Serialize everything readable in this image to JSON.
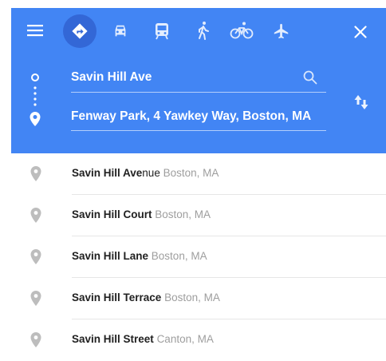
{
  "origin": {
    "value": "Savin Hill Ave"
  },
  "destination": {
    "value": "Fenway Park, 4 Yawkey Way, Boston, MA"
  },
  "suggestions": [
    {
      "match": "Savin Hill Ave",
      "rest": "nue",
      "locality": "Boston, MA"
    },
    {
      "match": "Savin Hill Court",
      "rest": "",
      "locality": "Boston, MA"
    },
    {
      "match": "Savin Hill Lane",
      "rest": "",
      "locality": "Boston, MA"
    },
    {
      "match": "Savin Hill Terrace",
      "rest": "",
      "locality": "Boston, MA"
    },
    {
      "match": "Savin Hill Street",
      "rest": "",
      "locality": "Canton, MA"
    }
  ],
  "icons": {
    "menu": "menu-icon",
    "modes": [
      "directions-icon",
      "car-icon",
      "transit-icon",
      "walk-icon",
      "bicycle-icon",
      "flight-icon"
    ],
    "close": "close-icon",
    "search": "search-icon",
    "swap": "swap-icon",
    "place": "place-icon"
  },
  "colors": {
    "header": "#4285f4",
    "active_mode": "#3367d6",
    "pin": "#bdbdbd"
  }
}
